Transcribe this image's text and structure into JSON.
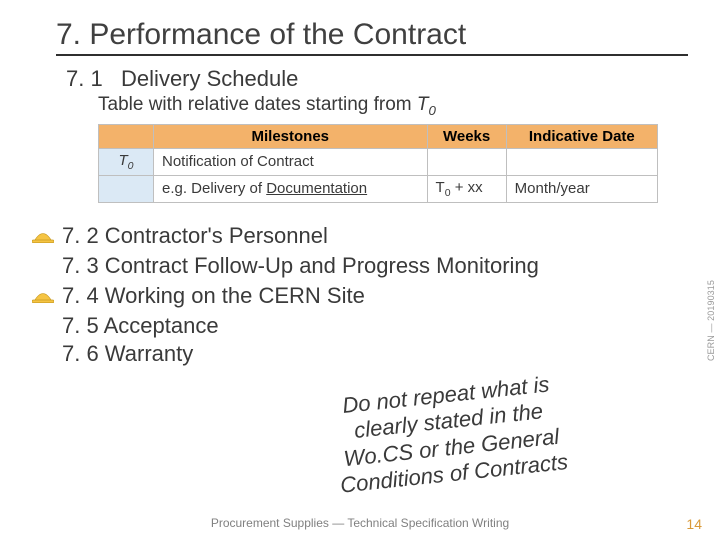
{
  "title": "7. Performance of the Contract",
  "section71_num": "7. 1",
  "section71_label": "Delivery Schedule",
  "tableCaptionPrefix": "Table with relative dates starting from ",
  "t0": "T",
  "t0sub": "0",
  "table": {
    "head": {
      "c0": "",
      "c1": "Milestones",
      "c2": "Weeks",
      "c3": "Indicative Date"
    },
    "r1": {
      "c0": "T",
      "c0sub": "0",
      "c1": "Notification of Contract",
      "c2": "",
      "c3": ""
    },
    "r2": {
      "c0": "",
      "c1a": "e.g. Delivery of ",
      "c1b": "Documentation",
      "c2a": "T",
      "c2sub": "0",
      "c2b": " + xx",
      "c3": "Month/year"
    }
  },
  "sections": {
    "s72": "7. 2 Contractor's Personnel",
    "s73": "7. 3 Contract Follow-Up and Progress Monitoring",
    "s74": "7. 4 Working on the CERN Site",
    "s75": "7. 5 Acceptance",
    "s76": "7. 6 Warranty"
  },
  "note_l1": "Do not repeat what is",
  "note_l2": "clearly stated in the",
  "note_l3": "Wo.CS or the General",
  "note_l4": "Conditions of Contracts",
  "footer": "Procurement Supplies — Technical Specification Writing",
  "pageNum": "14",
  "sideStamp": "CERN — 20190315"
}
